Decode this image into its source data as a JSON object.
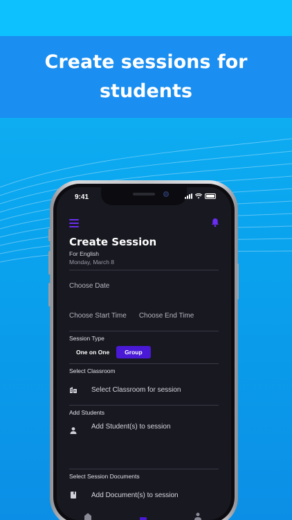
{
  "banner": {
    "title": "Create sessions for students"
  },
  "status_bar": {
    "time": "9:41"
  },
  "header": {
    "menu_icon": "hamburger-menu-icon",
    "bell_icon": "bell-icon",
    "accent": "#6a2ef0"
  },
  "session": {
    "title": "Create Session",
    "subject": "For English",
    "date": "Monday, March 8",
    "choose_date": "Choose Date",
    "choose_start_time": "Choose Start Time",
    "choose_end_time": "Choose End Time",
    "session_type_label": "Session Type",
    "type_one_on_one": "One on One",
    "type_group": "Group",
    "classroom_label": "Select Classroom",
    "classroom_placeholder": "Select Classroom for session",
    "students_label": "Add Students",
    "students_placeholder": "Add Student(s) to session",
    "documents_label": "Select Session Documents",
    "documents_placeholder": "Add Document(s) to session"
  }
}
